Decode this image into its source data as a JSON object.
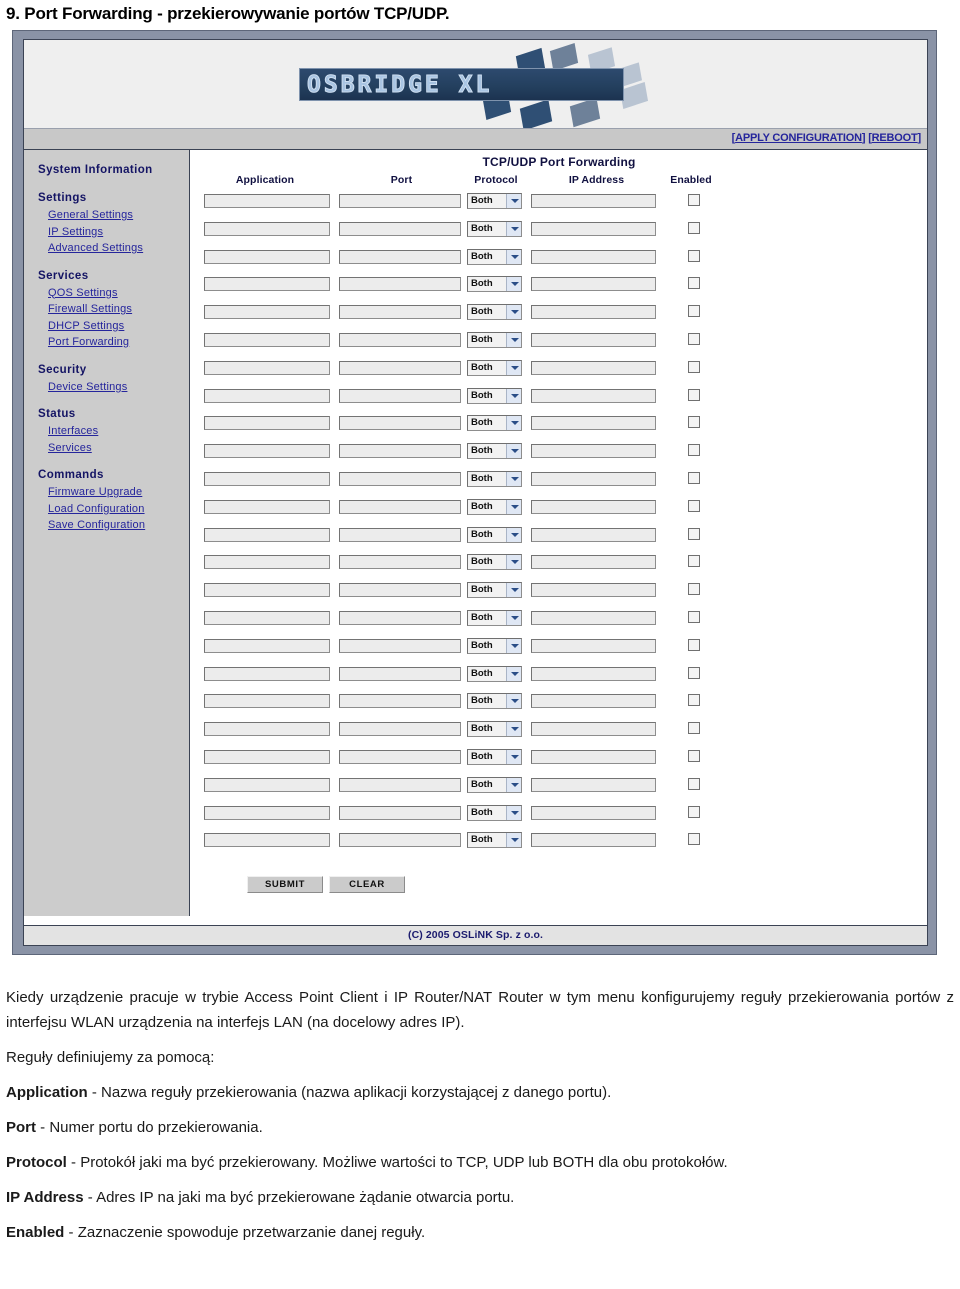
{
  "page_title": "9. Port Forwarding - przekierowywanie portów TCP/UDP.",
  "screenshot": {
    "logo": {
      "text": "OSBRIDGE XL",
      "brand_color": "#24405f"
    },
    "apply_bar": {
      "apply_label": "APPLY CONFIGURATION",
      "reboot_label": "REBOOT",
      "open_bracket": "[",
      "close_bracket": "]",
      "link_color": "#25259c"
    },
    "sidebar": {
      "groups": [
        {
          "heading": "System Information",
          "links": []
        },
        {
          "heading": "Settings",
          "links": [
            "General Settings",
            "IP Settings",
            "Advanced Settings"
          ]
        },
        {
          "heading": "Services",
          "links": [
            "QOS Settings",
            "Firewall Settings",
            "DHCP Settings",
            "Port Forwarding"
          ]
        },
        {
          "heading": "Security",
          "links": [
            "Device Settings"
          ]
        },
        {
          "heading": "Status",
          "links": [
            "Interfaces",
            "Services"
          ]
        },
        {
          "heading": "Commands",
          "links": [
            "Firmware Upgrade",
            "Load Configuration",
            "Save Configuration"
          ]
        }
      ]
    },
    "panel": {
      "title": "TCP/UDP Port Forwarding",
      "columns": [
        "Application",
        "Port",
        "Protocol",
        "IP Address",
        "Enabled"
      ],
      "row_count": 24,
      "row_defaults": {
        "application": "",
        "port": "",
        "protocol": "Both",
        "ip_address": "",
        "enabled": false
      },
      "protocol_options": [
        "Both",
        "TCP",
        "UDP"
      ],
      "buttons": {
        "submit": "SUBMIT",
        "clear": "CLEAR"
      }
    },
    "footer": {
      "copyright": "(C) 2005 OSLiNK Sp. z o.o."
    }
  },
  "prose": {
    "intro": "Kiedy urządzenie pracuje w trybie Access Point Client i IP Router/NAT Router w tym menu konfigurujemy reguły przekierowania portów z interfejsu WLAN urządzenia na interfejs LAN (na docelowy adres IP).",
    "lead": "Reguły definiujemy za pomocą:",
    "terms": [
      {
        "term": "Application",
        "sep": " - ",
        "desc": "Nazwa reguły przekierowania (nazwa aplikacji korzystającej z danego portu)."
      },
      {
        "term": "Port",
        "sep": " - ",
        "desc": "Numer portu do przekierowania."
      },
      {
        "term": "Protocol",
        "sep": " - ",
        "desc": "Protokół jaki ma być przekierowany. Możliwe wartości to TCP, UDP lub BOTH dla obu protokołów."
      },
      {
        "term": "IP Address",
        "sep": " - ",
        "desc": "Adres IP na jaki ma być przekierowane żądanie otwarcia portu."
      },
      {
        "term": "Enabled",
        "sep": " - ",
        "desc": "Zaznaczenie spowoduje przetwarzanie danej reguły."
      }
    ]
  }
}
